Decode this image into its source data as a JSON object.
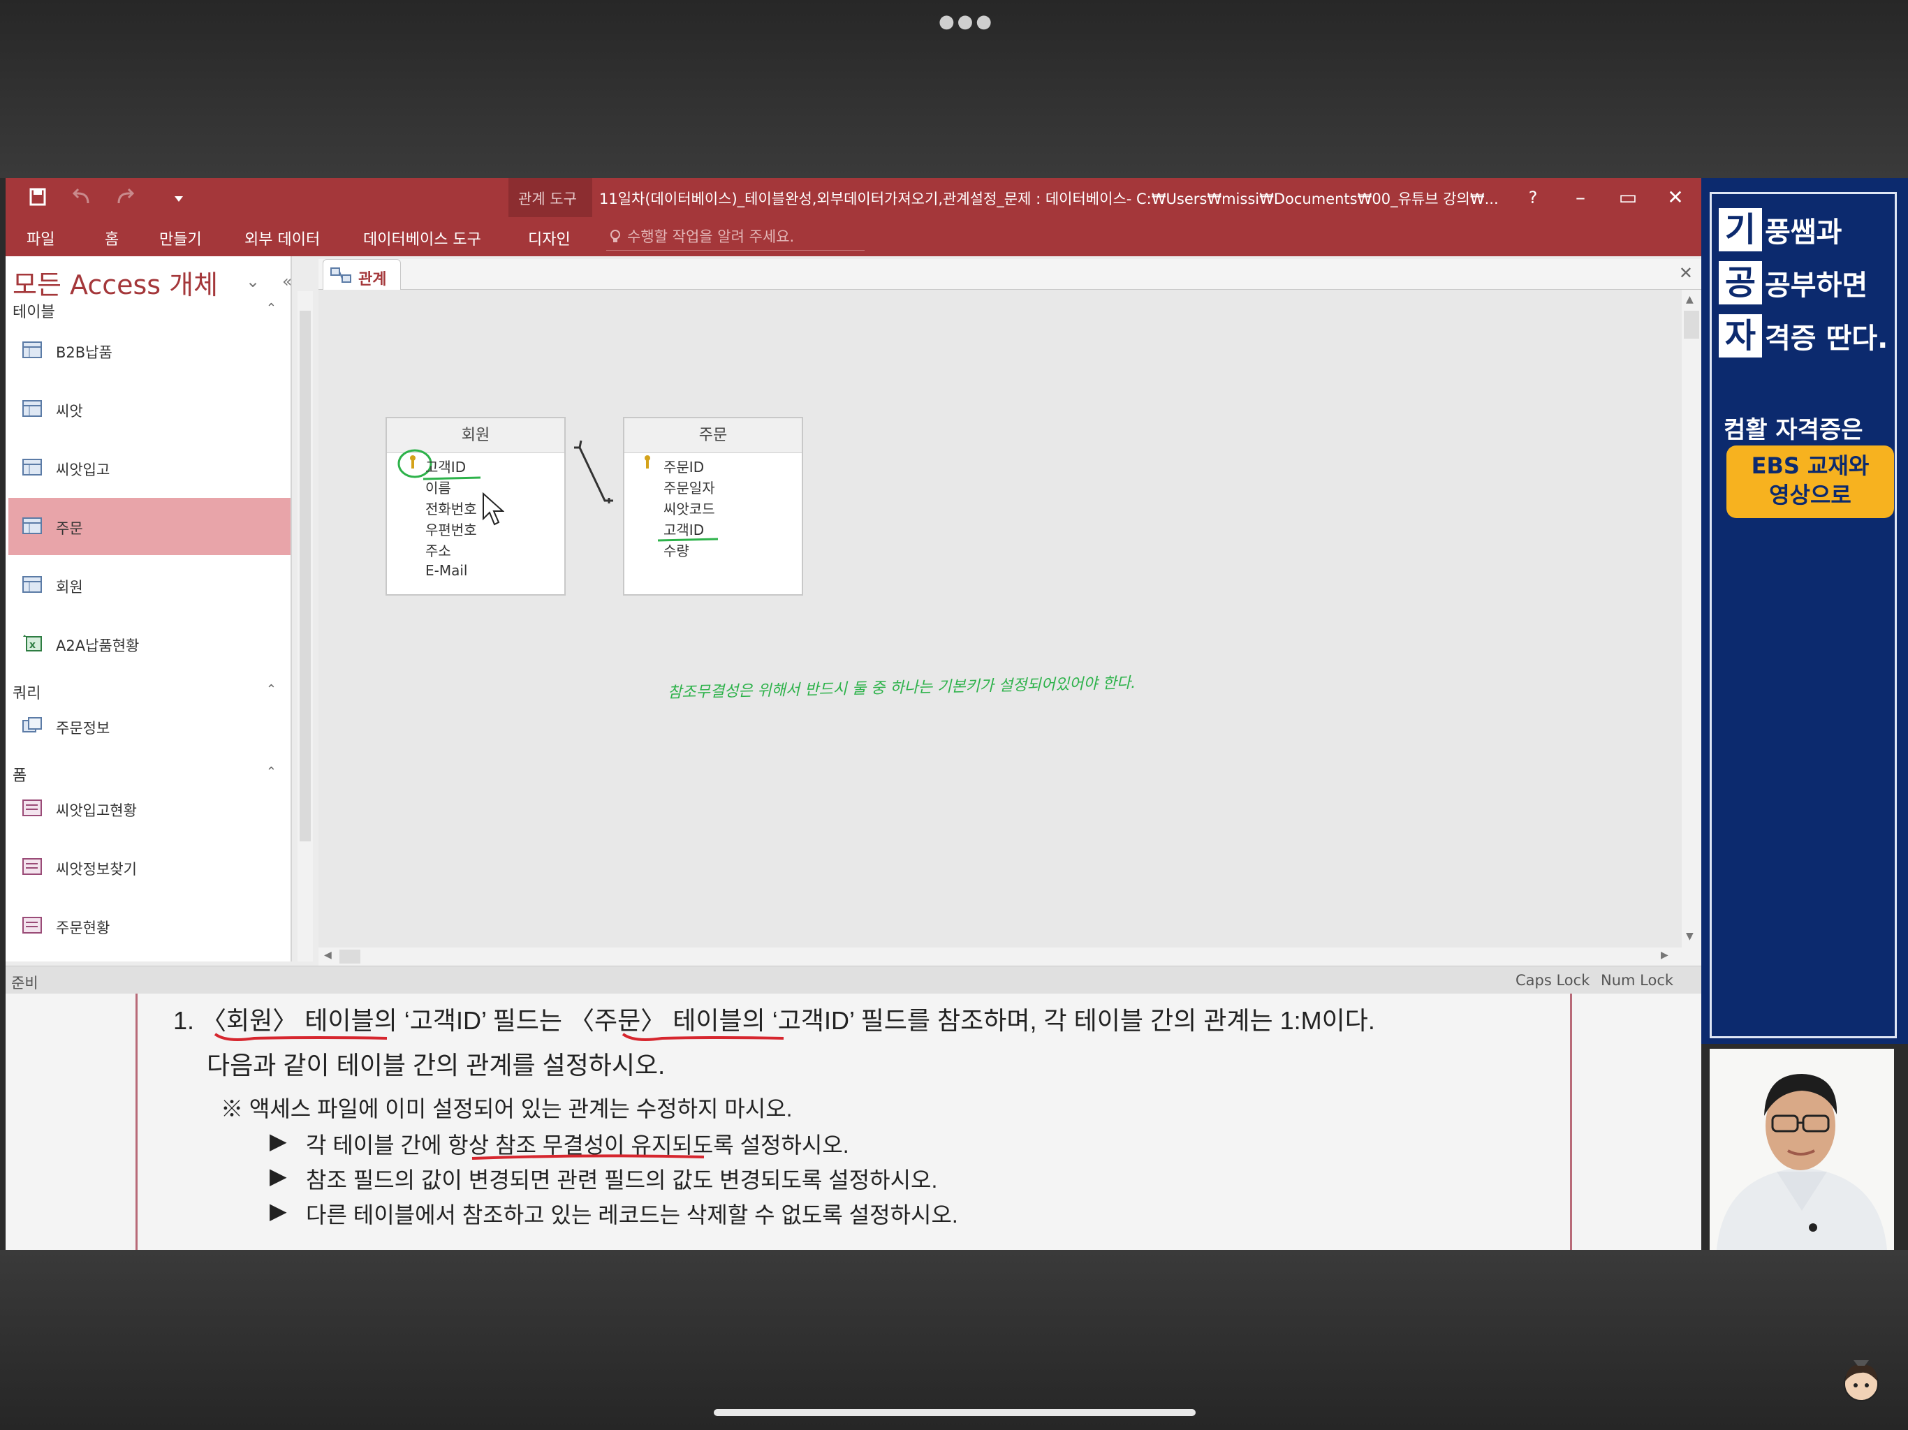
{
  "titlebar": {
    "context_tool": "관계 도구",
    "window_title": "11일차(데이터베이스)_테이블완성,외부데이터가져오기,관계설정_문제 : 데이터베이스- C:₩Users₩missi₩Documents₩00_유튜브 강의₩...",
    "help": "?",
    "minimize": "–",
    "maximize": "▭",
    "close": "✕"
  },
  "ribbon": {
    "tabs": [
      "파일",
      "홈",
      "만들기",
      "외부 데이터",
      "데이터베이스 도구",
      "디자인"
    ],
    "tell_me_placeholder": "수행할 작업을 알려 주세요."
  },
  "nav": {
    "title": "모든 Access 개체",
    "groups": {
      "tables": "테이블",
      "queries": "쿼리",
      "forms": "폼"
    },
    "tables": [
      "B2B납품",
      "씨앗",
      "씨앗입고",
      "주문",
      "회원",
      "A2A납품현황"
    ],
    "queries": [
      "주문정보"
    ],
    "forms": [
      "씨앗입고현황",
      "씨앗정보찾기",
      "주문현황"
    ],
    "selected": "주문"
  },
  "document": {
    "tab_label": "관계",
    "tables": [
      {
        "name": "회원",
        "fields": [
          "고객ID",
          "이름",
          "전화번호",
          "우편번호",
          "주소",
          "E-Mail"
        ]
      },
      {
        "name": "주문",
        "fields": [
          "주문ID",
          "주문일자",
          "씨앗코드",
          "고객ID",
          "수량"
        ]
      }
    ],
    "handwritten_note": "참조무결성은 위해서 반드시 둘 중 하나는 기본키가 설정되어있어야 한다."
  },
  "status": {
    "left": "준비",
    "caps": "Caps Lock",
    "num": "Num Lock"
  },
  "question": {
    "line1": "1. 〈회원〉 테이블의 ‘고객ID’ 필드는 〈주문〉 테이블의 ‘고객ID’ 필드를 참조하며, 각 테이블 간의 관계는 1:M이다.",
    "line2": "다음과 같이 테이블 간의 관계를 설정하시오.",
    "note": "※ 액세스 파일에 이미 설정되어 있는 관계는 수정하지 마시오.",
    "bullets": [
      "각 테이블 간에 항상 참조 무결성이 유지되도록 설정하시오.",
      "참조 필드의 값이 변경되면 관련 필드의 값도 변경되도록 설정하시오.",
      "다른 테이블에서 참조하고 있는 레코드는 삭제할 수 없도록 설정하시오."
    ],
    "bullet_marker": "▶"
  },
  "promo": {
    "rows": [
      {
        "box": "기",
        "text": "풍쌤과"
      },
      {
        "box": "공",
        "text": "공부하면"
      },
      {
        "box": "자",
        "text": "격증 딴다."
      }
    ],
    "sub": "컴활 자격증은",
    "badge_line1": "EBS 교재와",
    "badge_line2": "영상으로"
  },
  "colors": {
    "access_red": "#a4373a",
    "selected_item": "#e8a4a9",
    "promo_blue": "#0c2a6e",
    "badge_yellow": "#f7b21f",
    "annotation_green": "#2db24a"
  }
}
